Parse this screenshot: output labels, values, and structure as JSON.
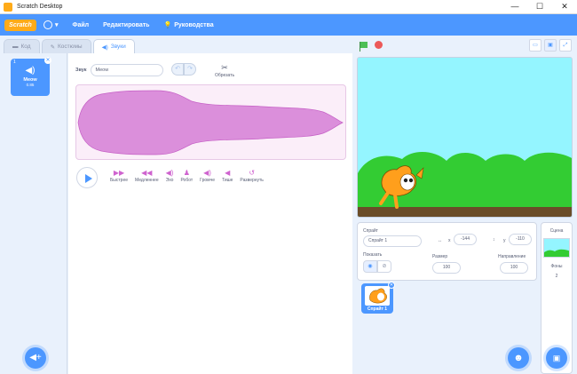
{
  "window": {
    "title": "Scratch Desktop",
    "minimize": "—",
    "maximize": "☐",
    "close": "✕"
  },
  "menubar": {
    "logo": "Scratch",
    "file": "Файл",
    "edit": "Редактировать",
    "tutorials": "Руководства"
  },
  "tabs": [
    {
      "label": "Код",
      "active": false
    },
    {
      "label": "Костюмы",
      "active": false
    },
    {
      "label": "Звуки",
      "active": true
    }
  ],
  "sound_list": {
    "items": [
      {
        "index": "1",
        "name": "Meow",
        "duration": "0.85"
      }
    ]
  },
  "editor": {
    "sound_label": "Звук",
    "sound_name": "Meow",
    "trim_label": "Обрезать",
    "effects": [
      {
        "label": "Быстрее",
        "icon": "faster-icon"
      },
      {
        "label": "Медленнее",
        "icon": "slower-icon"
      },
      {
        "label": "Эхо",
        "icon": "echo-icon"
      },
      {
        "label": "Робот",
        "icon": "robot-icon"
      },
      {
        "label": "Громче",
        "icon": "louder-icon"
      },
      {
        "label": "Тише",
        "icon": "softer-icon"
      },
      {
        "label": "Развернуть",
        "icon": "reverse-icon"
      }
    ]
  },
  "sprite_info": {
    "sprite_label": "Спрайт",
    "sprite_name": "Спрайт 1",
    "x_label": "x",
    "x_value": "-144",
    "y_label": "y",
    "y_value": "-110",
    "show_label": "Показать",
    "size_label": "Размер",
    "size_value": "100",
    "direction_label": "Направление",
    "direction_value": "100"
  },
  "sprites": [
    {
      "name": "Спрайт 1",
      "selected": true
    }
  ],
  "stage_selector": {
    "label": "Сцена",
    "backdrops_label": "Фоны",
    "backdrops_count": "2"
  },
  "colors": {
    "primary": "#4c97ff",
    "sound": "#cf63cf",
    "wave_fill": "#db8fdb",
    "sky": "#94f5ff",
    "grass": "#33cc33",
    "ground": "#6b4d29"
  }
}
